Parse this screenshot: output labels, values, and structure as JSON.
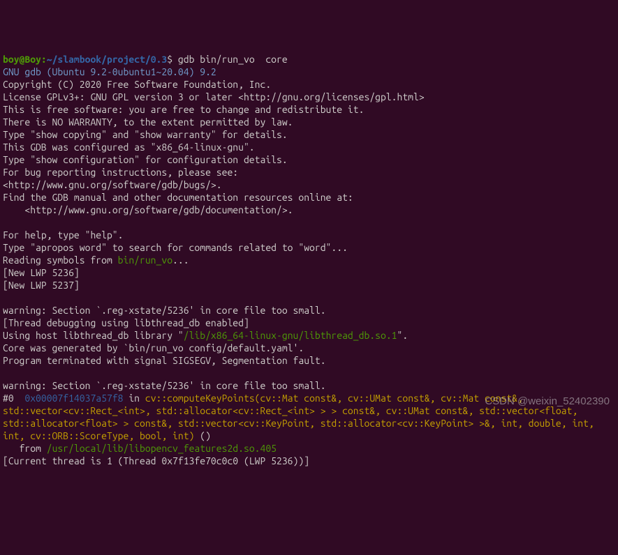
{
  "prompt": {
    "user": "boy@Boy",
    "colon": ":",
    "path": "~/slambook/project/0.3",
    "dollar": "$",
    "command": " gdb bin/run_vo  core"
  },
  "gdb": {
    "version_line": "GNU gdb (Ubuntu 9.2-0ubuntu1~20.04) 9.2",
    "copyright": "Copyright (C) 2020 Free Software Foundation, Inc.",
    "license": "License GPLv3+: GNU GPL version 3 or later <http://gnu.org/licenses/gpl.html>",
    "free": "This is free software: you are free to change and redistribute it.",
    "warranty": "There is NO WARRANTY, to the extent permitted by law.",
    "type_show": "Type \"show copying\" and \"show warranty\" for details.",
    "configured": "This GDB was configured as \"x86_64-linux-gnu\".",
    "type_config": "Type \"show configuration\" for configuration details.",
    "bugs1": "For bug reporting instructions, please see:",
    "bugs2": "<http://www.gnu.org/software/gdb/bugs/>.",
    "docs1": "Find the GDB manual and other documentation resources online at:",
    "docs2": "    <http://www.gnu.org/software/gdb/documentation/>.",
    "help1": "For help, type \"help\".",
    "help2": "Type \"apropos word\" to search for commands related to \"word\"...",
    "reading1": "Reading symbols from ",
    "reading_path": "bin/run_vo",
    "reading2": "...",
    "lwp1": "[New LWP 5236]",
    "lwp2": "[New LWP 5237]",
    "warning1": "warning: Section `.reg-xstate/5236' in core file too small.",
    "thread_dbg": "[Thread debugging using libthread_db enabled]",
    "using1": "Using host libthread_db library \"",
    "using_path": "/lib/x86_64-linux-gnu/libthread_db.so.1",
    "using2": "\".",
    "core_gen": "Core was generated by `bin/run_vo config/default.yaml'.",
    "sigsegv": "Program terminated with signal SIGSEGV, Segmentation fault.",
    "warning2": "warning: Section `.reg-xstate/5236' in core file too small.",
    "frame0_prefix": "#0  ",
    "frame0_addr": "0x00007f14037a57f8",
    "frame0_in": " in ",
    "frame0_sym": "cv::computeKeyPoints(cv::Mat const&, cv::UMat const&, cv::Mat const&, std::vector<cv::Rect_<int>, std::allocator<cv::Rect_<int> > > const&, cv::UMat const&, std::vector<float, std::allocator<float> > const&, std::vector<cv::KeyPoint, std::allocator<cv::KeyPoint> >&, int, double, int, int, cv::ORB::ScoreType, bool, int)",
    "frame0_tail": " ()",
    "from_prefix": "   from ",
    "from_path": "/usr/local/lib/libopencv_features2d.so.405",
    "current_thread": "[Current thread is 1 (Thread 0x7f13fe70c0c0 (LWP 5236))]"
  },
  "watermark": "CSDN @weixin_52402390"
}
